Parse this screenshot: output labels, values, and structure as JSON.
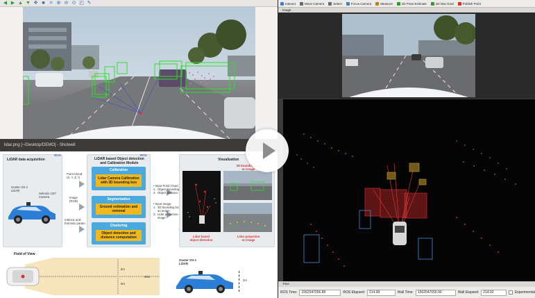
{
  "shotwell": {
    "toolbar_icons": [
      "arrow-left-icon",
      "arrow-right-icon",
      "arrow-up-icon",
      "arrow-down-icon",
      "select-icon",
      "save-icon",
      "crop-icon",
      "zoom-in-icon",
      "zoom-out-icon",
      "fit-icon",
      "fullscreen-icon",
      "tools-icon"
    ],
    "status_title": "lidar.png [~/Desktop/DEMO] - Shotwell"
  },
  "pipeline": {
    "acq_title": "LiDAR data acquisition",
    "acq_ros": "ROS",
    "ouster_label": "Ouster OS-1\nLiDAR",
    "camera_label": "Sekonix 120°\nCamera",
    "inputs": [
      "Point Cloud\n(X, Y, Z, I)",
      "Image\n(RGB)",
      "Intrinsic and\nExtrinsic param."
    ],
    "module_title": "LiDAR based Object detection\nand Calibration Module",
    "module_ros": "ROS",
    "steps": [
      {
        "title": "Calibration",
        "box": "Lidar Camera Calibration\nwith 3D bounding box"
      },
      {
        "title": "Segmentation",
        "box": "Ground estimation and\nremoval"
      },
      {
        "title": "Clustering",
        "box": "Object detection and\ndistance computation"
      }
    ],
    "io_top": "• Input Point Cloud\n1.  Object bounding box\n2.  Object distance",
    "io_bottom": "• Input Image\n1.  3D bounding box on\n     an image\n2.  Lidar projection on\n     image",
    "vis_title": "Visualization",
    "vis_top_caption": "3D bounding box\non image",
    "vis_left_caption": "Lidar based\nobject detection",
    "vis_right_caption": "Lidar projection\non image",
    "fov_title": "Field of View",
    "fov_5m_a": "5m",
    "fov_30m": "30m",
    "fov_5m_b": "5m",
    "side_lidar": "Ouster OS-1\nLiDAR",
    "side_2m": "2m"
  },
  "rviz": {
    "tools": [
      {
        "icon": "interact-icon",
        "label": "Interact",
        "color": "#4a7bc8"
      },
      {
        "icon": "move-camera-icon",
        "label": "Move Camera",
        "color": "#6a6a6a"
      },
      {
        "icon": "select-icon",
        "label": "Select",
        "color": "#6a6a6a"
      },
      {
        "icon": "focus-camera-icon",
        "label": "Focus Camera",
        "color": "#3a86c8"
      },
      {
        "icon": "measure-icon",
        "label": "Measure",
        "color": "#b8860b"
      },
      {
        "icon": "pose-estimate-icon",
        "label": "2D Pose Estimate",
        "color": "#2e9e2a"
      },
      {
        "icon": "nav-goal-icon",
        "label": "2D Nav Goal",
        "color": "#2e9e2a"
      },
      {
        "icon": "publish-point-icon",
        "label": "Publish Point",
        "color": "#d6322f"
      }
    ],
    "image_panel_label": "Image",
    "time_panel_label": "Time",
    "ros_time_label": "ROS Time:",
    "ros_time": "1562547056.88",
    "ros_elapsed_label": "ROS Elapsed:",
    "ros_elapsed": "214.99",
    "wall_time_label": "Wall Time:",
    "wall_time": "1562547056.90",
    "wall_elapsed_label": "Wall Elapsed:",
    "wall_elapsed": "214.92",
    "experimental_label": "Experimental"
  },
  "play_button": "play-icon"
}
